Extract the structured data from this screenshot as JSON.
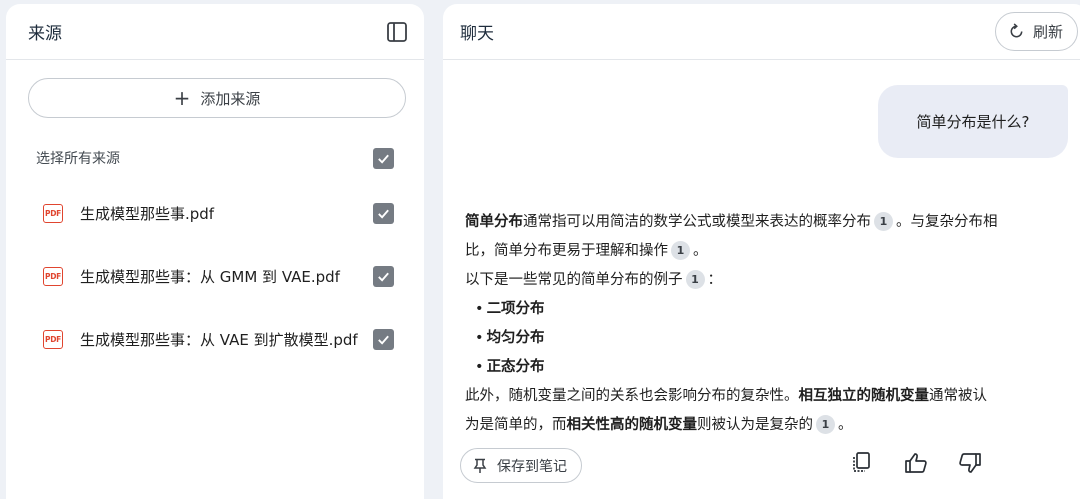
{
  "sources_panel": {
    "title": "来源",
    "add_source_label": "添加来源",
    "select_all_label": "选择所有来源",
    "items": [
      {
        "icon_text": "PDF",
        "name": "生成模型那些事.pdf"
      },
      {
        "icon_text": "PDF",
        "name": "生成模型那些事：从 GMM 到 VAE.pdf"
      },
      {
        "icon_text": "PDF",
        "name": "生成模型那些事：从 VAE 到扩散模型.pdf"
      }
    ]
  },
  "chat_panel": {
    "title": "聊天",
    "refresh_label": "刷新",
    "user_message": "简单分布是什么?",
    "answer": {
      "p1_bold": "简单分布",
      "p1_text1": "通常指可以用简洁的数学公式或模型来表达的概率分布",
      "p1_text2": "。与复杂分布相比，简单分布更易于理解和操作",
      "p1_text3": "。",
      "p2_text": "以下是一些常见的简单分布的例子",
      "p2_colon": "：",
      "list": [
        "二项分布",
        "均匀分布",
        "正态分布"
      ],
      "p3_text1": "此外，随机变量之间的关系也会影响分布的复杂性。",
      "p3_bold1": "相互独立的随机变量",
      "p3_text2": "通常被认为是简单的，而",
      "p3_bold2": "相关性高的随机变量",
      "p3_text3": "则被认为是复杂的",
      "p3_end": "。",
      "citation": "1"
    },
    "save_note_label": "保存到笔记"
  },
  "colors": {
    "background": "#eef1f6",
    "panel": "#ffffff",
    "pdf_red": "#e0452f",
    "checkbox": "#757b83",
    "user_bubble": "#e9ecf5"
  },
  "icons": {
    "collapse": "panel-collapse-icon",
    "plus": "plus-icon",
    "pdf": "pdf-icon",
    "check": "check-icon",
    "refresh": "refresh-icon",
    "pin": "pin-icon",
    "copy": "copy-icon",
    "thumb_up": "thumb-up-icon",
    "thumb_down": "thumb-down-icon"
  }
}
